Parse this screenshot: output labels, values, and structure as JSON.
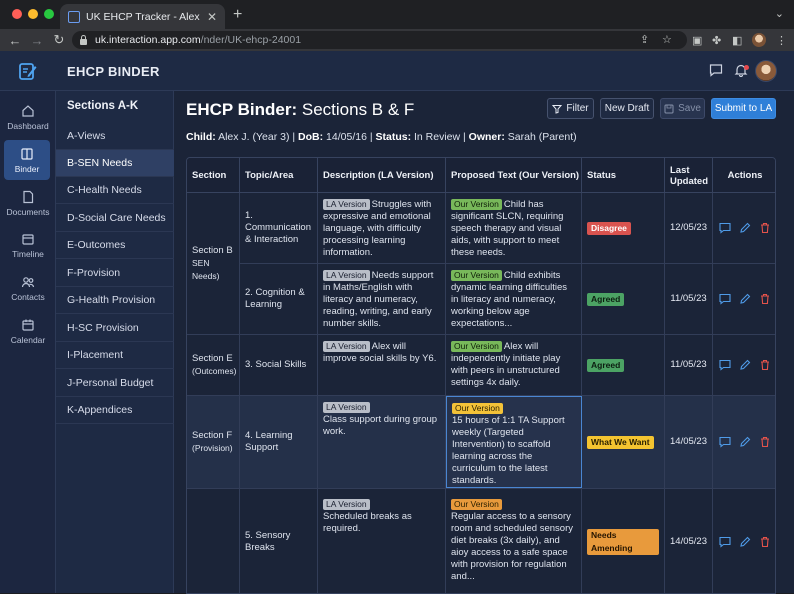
{
  "browser": {
    "tab_title": "UK EHCP Tracker - Alex J. - Ca",
    "url_host": "uk.interaction.app.com",
    "url_path": "/nder/UK-ehcp-24001"
  },
  "app": {
    "title": "EHCP BINDER"
  },
  "rail": [
    {
      "label": "Dashboard",
      "icon": "home-icon"
    },
    {
      "label": "Binder",
      "icon": "binder-icon",
      "active": true
    },
    {
      "label": "Documents",
      "icon": "document-icon"
    },
    {
      "label": "Timeline",
      "icon": "calendar-icon"
    },
    {
      "label": "Contacts",
      "icon": "contacts-icon"
    },
    {
      "label": "Calendar",
      "icon": "calendar-icon"
    }
  ],
  "sections": {
    "heading": "Sections A-K",
    "items": [
      "A-Views",
      "B-SEN Needs",
      "C-Health Needs",
      "D-Social Care Needs",
      "E-Outcomes",
      "F-Provision",
      "G-Health Provision",
      "H-SC Provision",
      "I-Placement",
      "J-Personal Budget",
      "K-Appendices"
    ]
  },
  "main": {
    "title_bold": "EHCP Binder:",
    "title_rest": " Sections B & F",
    "buttons": {
      "filter": "Filter",
      "new_draft": "New Draft",
      "save": "Save",
      "submit": "Submit to LA"
    },
    "meta": {
      "child_label": "Child:",
      "child_value": " Alex J. (Year 3) | ",
      "dob_label": "DoB:",
      "dob_value": " 14/05/16 | ",
      "status_label": "Status:",
      "status_value": " In Review | ",
      "owner_label": "Owner:",
      "owner_value": " Sarah (Parent)"
    }
  },
  "table": {
    "headers": {
      "section": "Section",
      "topic": "Topic/Area",
      "desc": "Description (LA Version)",
      "proposed": "Proposed Text (Our Version)",
      "status": "Status",
      "updated_1": "Last",
      "updated_2": "Updated",
      "actions": "Actions"
    },
    "tag_la": "LA Version",
    "tag_ours": "Our Version",
    "groups": {
      "b_line1": "Section B",
      "b_line2": "SEN Needs)",
      "e_line1": "Section E",
      "e_line2": "(Outcomes)",
      "f_line1": "Section F",
      "f_line2": "(Provision)"
    },
    "rows": [
      {
        "topic": "1. Communication & Interaction",
        "desc": "Struggles with expressive and emotional language, with difficulty processing learning information.",
        "proposed": "Child has significant SLCN, requiring speech therapy and visual aids, with support to meet these needs.",
        "status": "Disagree",
        "date": "12/05/23"
      },
      {
        "topic": "2. Cognition & Learning",
        "desc": "Needs support in Maths/English with literacy and numeracy, reading, writing, and early number skills.",
        "proposed": "Child exhibits dynamic learning difficulties in literacy and numeracy, working below age expectations...",
        "status": "Agreed",
        "date": "11/05/23"
      },
      {
        "topic": "3. Social Skills",
        "desc": "Alex will improve social skills by Y6.",
        "proposed": "Alex will independently initiate play with peers in unstructured settings 4x daily.",
        "status": "Agreed",
        "date": "11/05/23"
      },
      {
        "topic": "4. Learning Support",
        "desc": "Class support during group work.",
        "proposed": "15 hours of 1:1 TA Support weekly (Targeted Intervention) to scaffold learning across the curriculum to the latest standards.",
        "status": "What We Want",
        "date": "14/05/23"
      },
      {
        "topic": "5. Sensory Breaks",
        "desc": "Scheduled breaks as required.",
        "proposed": "Regular access to a sensory room and scheduled sensory diet breaks (3x daily), and aioy access to a safe space with provision for regulation and...",
        "status": "Needs Amending",
        "date": "14/05/23"
      }
    ]
  },
  "colors": {
    "disagree": "#d9534f",
    "agreed": "#4ca364",
    "what_we_want": "#f4c430",
    "needs_amending": "#e89a3c",
    "accent": "#2f7fd8"
  }
}
